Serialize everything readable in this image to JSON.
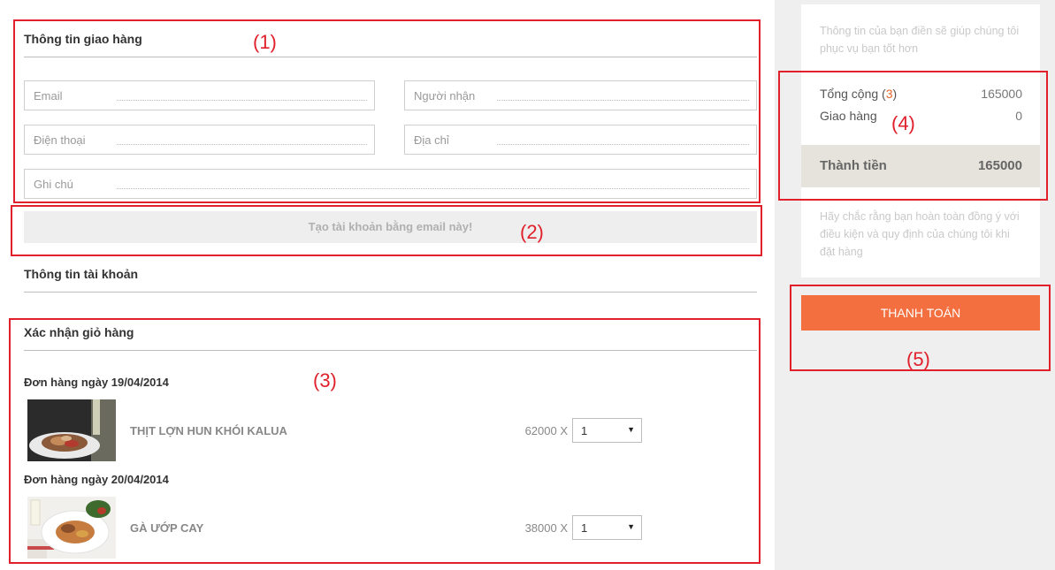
{
  "shipping": {
    "title": "Thông tin giao hàng",
    "fields": {
      "email": {
        "label": "Email",
        "value": ""
      },
      "recipient": {
        "label": "Người nhận",
        "value": ""
      },
      "phone": {
        "label": "Điện thoại",
        "value": ""
      },
      "address": {
        "label": "Địa chỉ",
        "value": ""
      },
      "note": {
        "label": "Ghi chú",
        "value": ""
      }
    }
  },
  "create_account_label": "Tạo tài khoản bằng email này!",
  "account": {
    "title": "Thông tin tài khoản"
  },
  "cart": {
    "title": "Xác nhận giỏ hàng",
    "orders": [
      {
        "date_label": "Đơn hàng ngày 19/04/2014",
        "item_name": "THỊT LỢN HUN KHÓI KALUA",
        "price": "62000 X",
        "qty": "1"
      },
      {
        "date_label": "Đơn hàng ngày 20/04/2014",
        "item_name": "GÀ ƯỚP CAY",
        "price": "38000 X",
        "qty": "1"
      }
    ]
  },
  "sidebar": {
    "intro_text": "Thông tin của bạn điền sẽ giúp chúng tôi phục vụ bạn tốt hơn",
    "total_label": "Tổng cộng (",
    "total_count": "3",
    "total_close": ")",
    "total_value": "165000",
    "shipping_label": "Giao hàng",
    "shipping_value": "0",
    "grand_label": "Thành tiền",
    "grand_value": "165000",
    "terms_text": "Hãy chắc rằng bạn hoàn toàn đồng ý với điều kiện và quy định của chúng tôi khi đặt hàng",
    "pay_label": "THANH TOÁN"
  },
  "annotations": [
    "(1)",
    "(2)",
    "(3)",
    "(4)",
    "(5)"
  ],
  "colors": {
    "annotation_red": "#e0202a",
    "pay_orange": "#f36f3f",
    "total_band": "#e5e3db",
    "sidebar_bg": "#efefef"
  }
}
